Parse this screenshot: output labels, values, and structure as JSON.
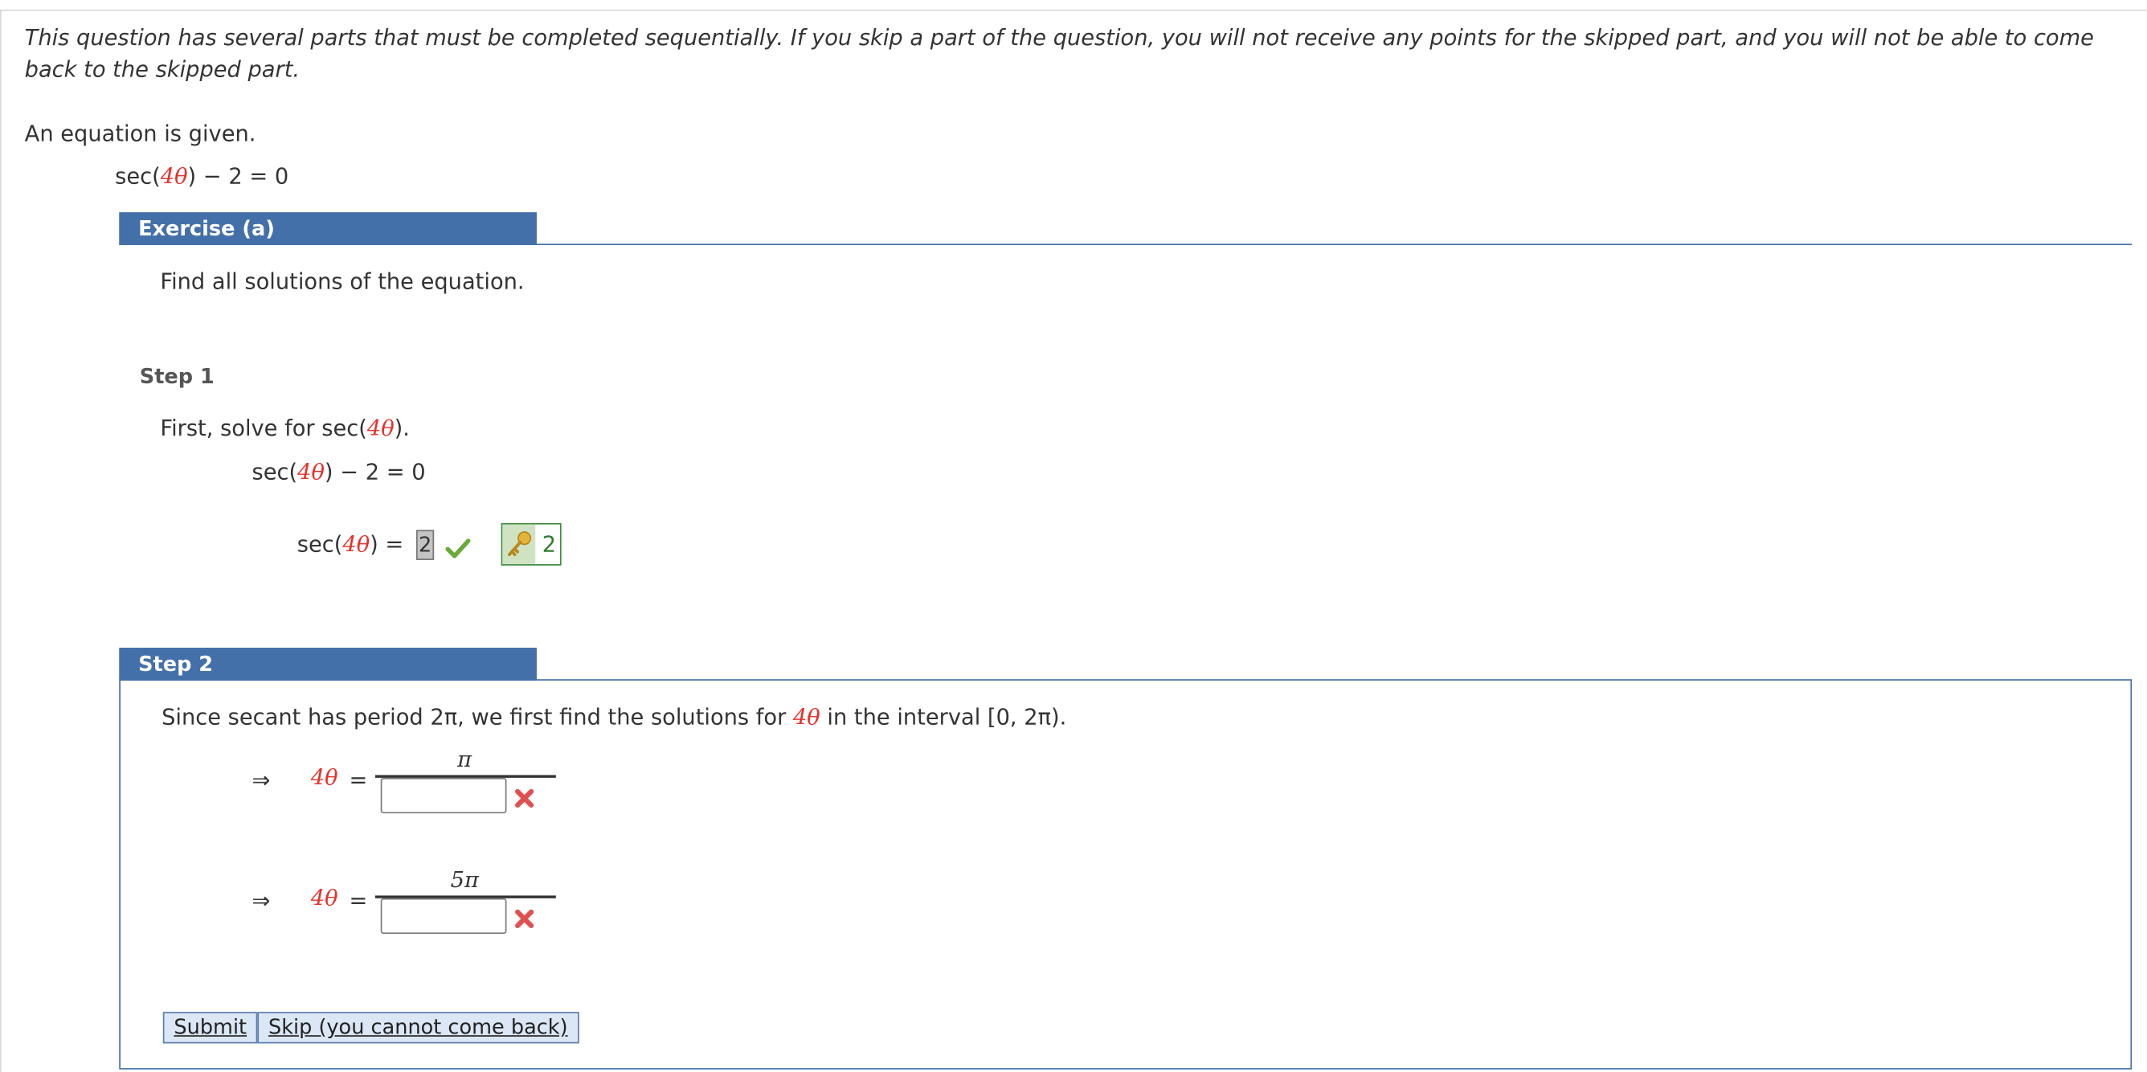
{
  "intro": "This question has several parts that must be completed sequentially. If you skip a part of the question, you will not receive any points for the skipped part, and you will not be able to come back to the skipped part.",
  "given_label": "An equation is given.",
  "equation": {
    "lhs_pre": "sec(",
    "coef": "4θ",
    "lhs_post": ") − 2 = 0"
  },
  "exercise": {
    "title": "Exercise (a)",
    "prompt": "Find all solutions of the equation."
  },
  "step1": {
    "label": "Step 1",
    "instruction_pre": "First, solve for  sec(",
    "instruction_coef": "4θ",
    "instruction_post": ").",
    "eq_pre": "sec(",
    "eq_coef": "4θ",
    "eq_post": ") − 2  =  0",
    "answer_lhs_pre": "sec(",
    "answer_lhs_coef": "4θ",
    "answer_lhs_post": ")   =",
    "answer_value": "2",
    "answer_status": "correct",
    "key_value": "2",
    "colors": {
      "check": "#6aaa3a",
      "key_border": "#3f8a3f"
    }
  },
  "step2": {
    "label": "Step 2",
    "text_pre": "Since secant has period 2π, we first find the solutions for ",
    "text_coef": "4θ",
    "text_post": " in the interval  [0, 2π).",
    "rows": [
      {
        "arrow": "⇒",
        "lhs": "4θ",
        "eq": "=",
        "numerator": "π",
        "denominator_value": "",
        "status": "incorrect"
      },
      {
        "arrow": "⇒",
        "lhs": "4θ",
        "eq": "=",
        "numerator": "5π",
        "denominator_value": "",
        "status": "incorrect"
      }
    ],
    "submit_label": "Submit",
    "skip_label": "Skip (you cannot come back)",
    "colors": {
      "cross": "#e05050",
      "accent": "#4470aa"
    }
  }
}
